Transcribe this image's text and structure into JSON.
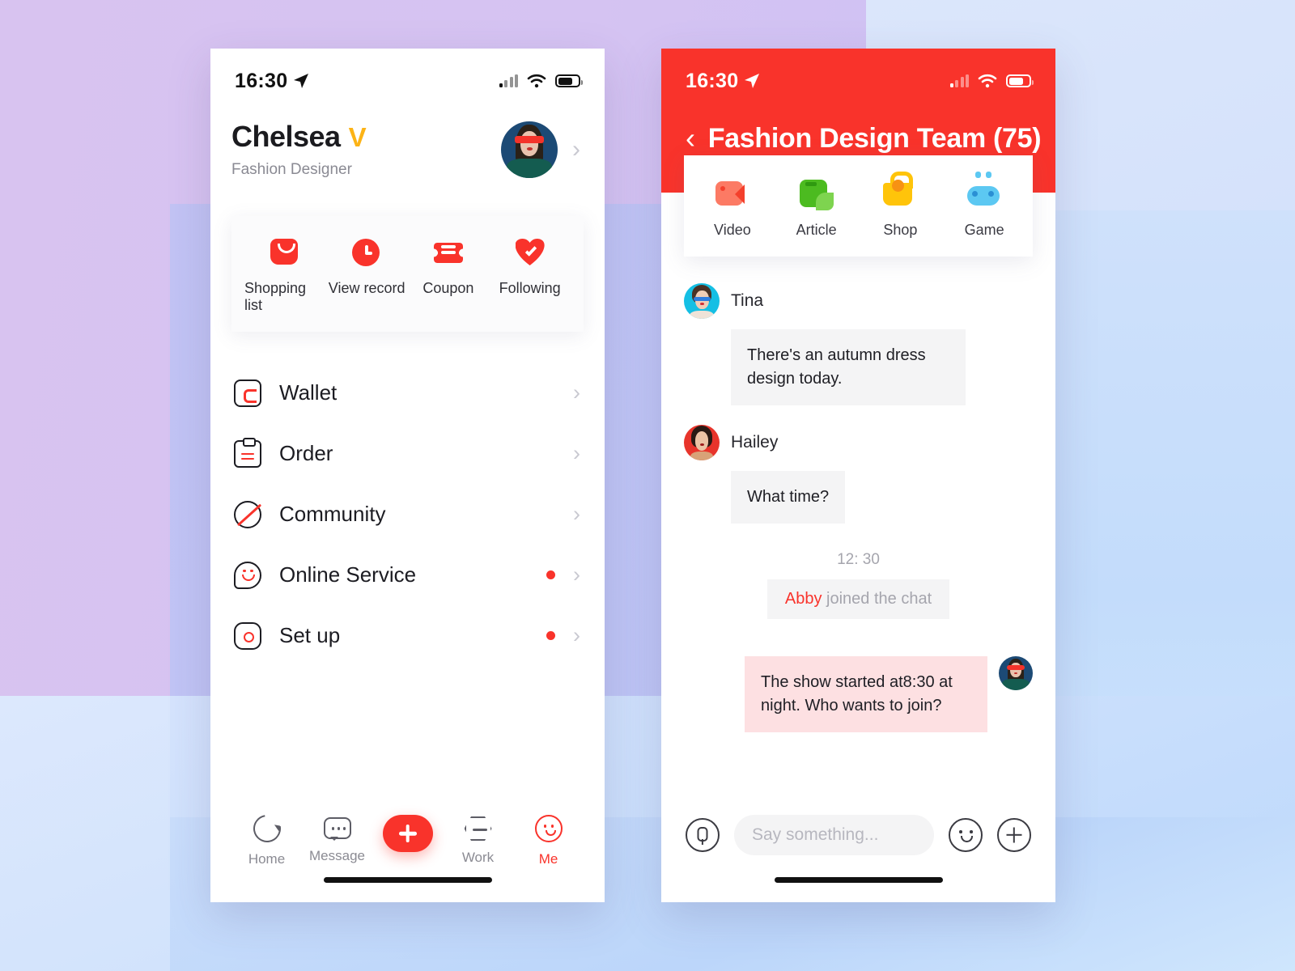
{
  "background": {
    "lilac": "#d8c3f0",
    "periwinkle": "#dbe6fb",
    "pale_blue": "#cfe1fb",
    "indigo": "#c2c3f4"
  },
  "accent": {
    "red": "#f9332b",
    "gold": "#fcb316"
  },
  "left_phone": {
    "status": {
      "time": "16:30",
      "location_icon": "location-arrow-icon",
      "signal_icon": "signal-bars-icon",
      "wifi_icon": "wifi-icon",
      "battery_icon": "battery-icon"
    },
    "profile": {
      "name": "Chelsea",
      "verified_badge": "V",
      "role": "Fashion Designer",
      "avatar": "chelsea-avatar",
      "chevron": "›"
    },
    "quick_actions": [
      {
        "icon": "shopping-bag-icon",
        "label": "Shopping list"
      },
      {
        "icon": "clock-icon",
        "label": "View record"
      },
      {
        "icon": "ticket-icon",
        "label": "Coupon"
      },
      {
        "icon": "heart-check-icon",
        "label": "Following"
      }
    ],
    "menu": [
      {
        "icon": "wallet-icon",
        "label": "Wallet",
        "badge": false
      },
      {
        "icon": "order-icon",
        "label": "Order",
        "badge": false
      },
      {
        "icon": "community-icon",
        "label": "Community",
        "badge": false
      },
      {
        "icon": "service-icon",
        "label": "Online Service",
        "badge": true
      },
      {
        "icon": "settings-icon",
        "label": "Set up",
        "badge": true
      }
    ],
    "tabbar": [
      {
        "icon": "home-icon",
        "label": "Home",
        "active": false
      },
      {
        "icon": "message-icon",
        "label": "Message",
        "active": false
      },
      {
        "icon": "work-icon",
        "label": "Work",
        "active": false
      },
      {
        "icon": "me-icon",
        "label": "Me",
        "active": true
      }
    ],
    "fab": {
      "icon": "plus-icon",
      "label": ""
    }
  },
  "right_phone": {
    "status": {
      "time": "16:30"
    },
    "header": {
      "back": "‹",
      "title": "Fashion Design Team (75)"
    },
    "tabs": [
      {
        "icon": "video-icon",
        "label": "Video"
      },
      {
        "icon": "article-icon",
        "label": "Article"
      },
      {
        "icon": "shop-icon",
        "label": "Shop"
      },
      {
        "icon": "game-icon",
        "label": "Game"
      }
    ],
    "messages": [
      {
        "sender": "Tina",
        "avatar": "tina-avatar",
        "text": "There's an autumn dress design today."
      },
      {
        "sender": "Hailey",
        "avatar": "hailey-avatar",
        "text": "What time?"
      }
    ],
    "system": {
      "time": "12: 30",
      "highlight": "Abby",
      "text": " joined the chat"
    },
    "outgoing": {
      "avatar": "chelsea-avatar",
      "text": "The show started at8:30 at night. Who wants to join?"
    },
    "composer": {
      "mic_icon": "microphone-icon",
      "placeholder": "Say something...",
      "emoji_icon": "smiley-icon",
      "add_icon": "plus-circle-icon"
    }
  }
}
